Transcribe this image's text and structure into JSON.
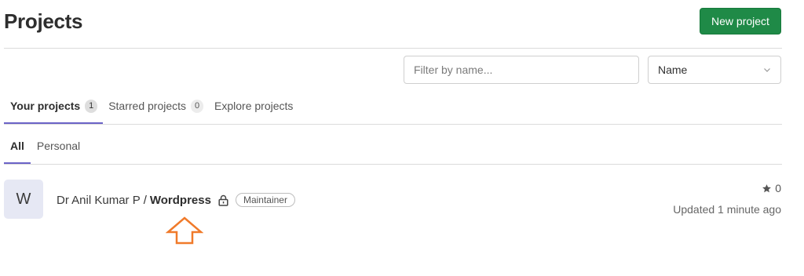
{
  "header": {
    "title": "Projects",
    "new_project_label": "New project"
  },
  "filter": {
    "placeholder": "Filter by name...",
    "value": ""
  },
  "sort": {
    "selected": "Name"
  },
  "tabs": [
    {
      "label": "Your projects",
      "count": "1"
    },
    {
      "label": "Starred projects",
      "count": "0"
    },
    {
      "label": "Explore projects"
    }
  ],
  "subtabs": [
    {
      "label": "All"
    },
    {
      "label": "Personal"
    }
  ],
  "project": {
    "avatar_letter": "W",
    "namespace": "Dr Anil Kumar P",
    "separator": "/",
    "name": "Wordpress",
    "role": "Maintainer",
    "stars": "0",
    "updated": "Updated 1 minute ago"
  },
  "colors": {
    "accent": "#1f8a47",
    "tab_underline": "#6b63c7",
    "annotation_arrow": "#f07a2a"
  },
  "icons": {
    "visibility": "lock-icon",
    "star": "star-icon",
    "dropdown": "chevron-down-icon",
    "annotation": "up-arrow-annotation"
  }
}
